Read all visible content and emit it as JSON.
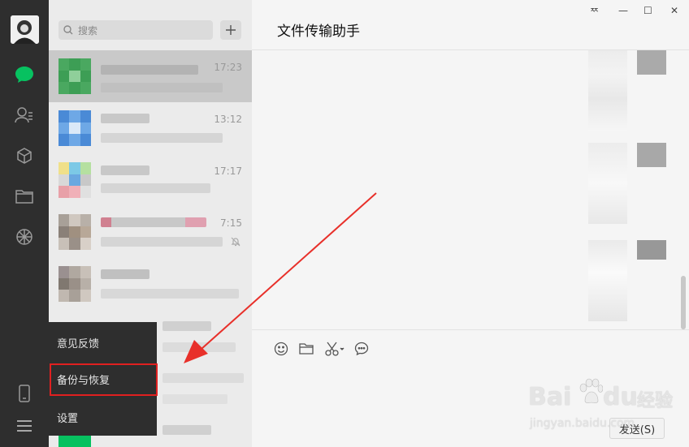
{
  "nav": {
    "items": [
      "chat",
      "contacts",
      "favorites",
      "files",
      "moments",
      "phone",
      "more"
    ]
  },
  "search": {
    "placeholder": "搜索"
  },
  "chats": [
    {
      "time": "17:23"
    },
    {
      "time": "13:12"
    },
    {
      "time": "17:17"
    },
    {
      "time": "7:15"
    }
  ],
  "menu": {
    "items": [
      "意见反馈",
      "备份与恢复",
      "设置"
    ]
  },
  "conversation": {
    "title": "文件传输助手",
    "send_label": "发送(S)"
  },
  "window": {
    "pin": "ᅑ",
    "minimize": "—",
    "maximize": "☐",
    "close": "✕"
  },
  "watermark": {
    "brand": "Bai",
    "brand2": "du",
    "cn": "经验",
    "url": "jingyan.baidu.com"
  },
  "colors": {
    "nav_bg": "#2e2e2e",
    "accent": "#07c160",
    "highlight": "#e02020"
  }
}
